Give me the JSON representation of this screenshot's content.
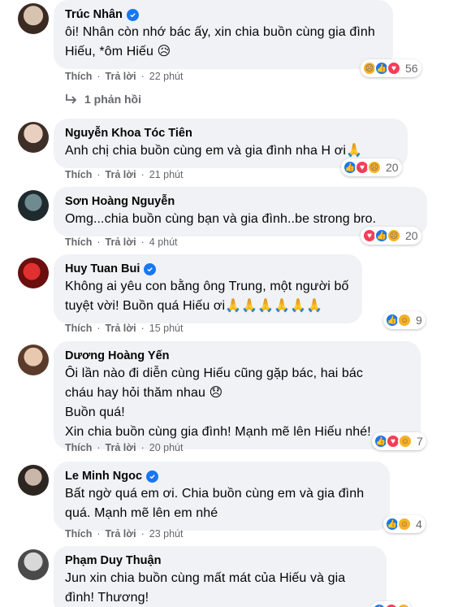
{
  "comments": [
    {
      "name": "Trúc Nhân",
      "verified": true,
      "lines": [
        "ôi! Nhân còn nhớ bác ấy, xin chia buồn cùng gia đình",
        "Hiếu, *ôm Hiếu 😥"
      ],
      "like": "Thích",
      "reply": "Trả lời",
      "time": "22 phút",
      "reactions": [
        "sad",
        "like",
        "love"
      ],
      "count": "56"
    },
    {
      "name": "Nguyễn Khoa Tóc Tiên",
      "verified": false,
      "lines": [
        "Anh chị chia buồn cùng em và gia đình nha H ơi🙏"
      ],
      "like": "Thích",
      "reply": "Trả lời",
      "time": "21 phút",
      "reactions": [
        "like",
        "love",
        "sad"
      ],
      "count": "20"
    },
    {
      "name": "Sơn Hoàng Nguyễn",
      "verified": false,
      "lines": [
        "Omg...chia buồn cùng bạn và gia đình..be strong bro."
      ],
      "like": "Thích",
      "reply": "Trả lời",
      "time": "4 phút",
      "reactions": [
        "love",
        "like",
        "sad"
      ],
      "count": "20"
    },
    {
      "name": "Huy Tuan Bui",
      "verified": true,
      "lines": [
        "Không ai yêu con bằng ông Trung, một người bố",
        "tuyệt vời! Buồn quá Hiếu ơi🙏🙏🙏🙏🙏🙏"
      ],
      "like": "Thích",
      "reply": "Trả lời",
      "time": "15 phút",
      "reactions": [
        "like",
        "care"
      ],
      "count": "9"
    },
    {
      "name": "Dương Hoàng Yến",
      "verified": false,
      "lines": [
        "Ôi lần nào đi diễn cùng Hiếu cũng gặp bác, hai bác",
        "cháu hay hỏi thăm nhau 😞",
        "Buồn quá!",
        "Xin chia buồn cùng gia đình! Mạnh mẽ lên Hiếu nhé!"
      ],
      "like": "Thích",
      "reply": "Trả lời",
      "time": "20 phút",
      "reactions": [
        "like",
        "love",
        "care"
      ],
      "count": "7"
    },
    {
      "name": "Le Minh Ngoc",
      "verified": true,
      "lines": [
        "Bất ngờ quá em ơi. Chia buồn cùng em và gia đình",
        "quá. Mạnh mẽ lên em nhé"
      ],
      "like": "Thích",
      "reply": "Trả lời",
      "time": "23 phút",
      "reactions": [
        "like",
        "care"
      ],
      "count": "4"
    },
    {
      "name": "Phạm Duy Thuận",
      "verified": false,
      "lines": [
        "Jun xin chia buồn cùng mất mát của Hiếu và gia",
        "đình! Thương!"
      ],
      "like": "",
      "reply": "",
      "time": "",
      "reactions": [
        "like",
        "love",
        "care"
      ],
      "count": ""
    }
  ],
  "replies_link": "1 phản hồi",
  "icons": {
    "verified": "verified-check-icon",
    "reply_arrow": "reply-arrow-icon"
  },
  "colors": {
    "bubble": "#f0f2f5",
    "meta": "#65676b",
    "like": "#1877f2",
    "love": "#f33e58",
    "sad": "#f7b125"
  }
}
